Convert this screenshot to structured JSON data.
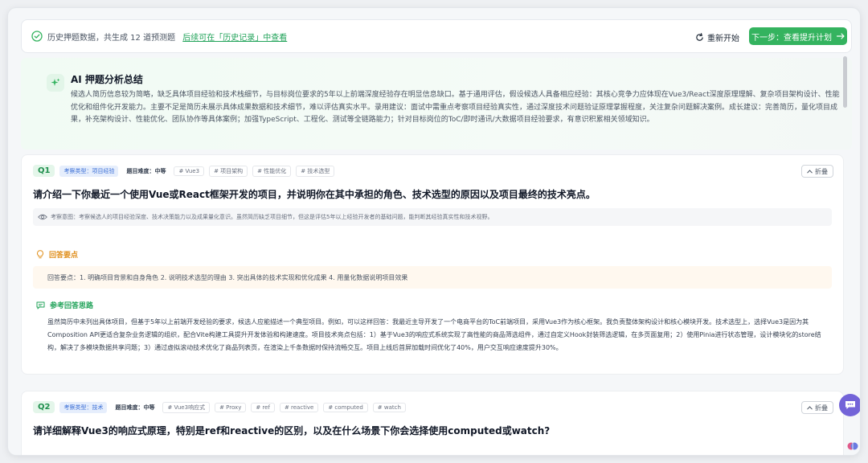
{
  "header": {
    "status_text": "历史押题数据，共生成 12 道预测题",
    "history_link": "后续可在「历史记录」中查看",
    "restart_label": "重新开始",
    "next_label": "下一步：查看提升计划"
  },
  "summary": {
    "title": "AI 押题分析总结",
    "body": "候选人简历信息较为简略，缺乏具体项目经验和技术栈细节，与目标岗位要求的5年以上前端深度经验存在明显信息缺口。基于通用评估，假设候选人具备相应经验：其核心竞争力应体现在Vue3/React深度原理理解、复杂项目架构设计、性能优化和组件化开发能力。主要不足是简历未展示具体成果数据和技术细节，难以评估真实水平。录用建议：面试中需重点考察项目经验真实性，通过深度技术问题验证原理掌握程度，关注复杂问题解决案例。成长建议：完善简历，量化项目成果，补充架构设计、性能优化、团队协作等具体案例；加强TypeScript、工程化、测试等全链路能力；针对目标岗位的ToC/即时通讯/大数据项目经验要求，有意识积累相关领域知识。"
  },
  "questions": [
    {
      "number": "Q1",
      "type": "考察类型：项目经验",
      "difficulty": "题目难度：中等",
      "tags": [
        "# Vue3",
        "# 项目架构",
        "# 性能优化",
        "# 技术选型"
      ],
      "fold_label": "折叠",
      "title": "请介绍一下你最近一个使用Vue或React框架开发的项目，并说明你在其中承担的角色、技术选型的原因以及项目最终的技术亮点。",
      "intent": "考察意图：考察候选人的项目经验深度、技术决策能力以及成果量化意识。虽然简历缺乏项目细节，但这是评估5年以上经验开发者的基础问题，能判断其经验真实性和技术视野。",
      "points_heading": "回答要点",
      "points": "回答要点：1. 明确项目背景和自身角色 2. 说明技术选型的理由 3. 突出具体的技术实现和优化成果 4. 用量化数据说明项目效果",
      "answer_heading": "参考回答思路",
      "answer": "虽然简历中未列出具体项目，但基于5年以上前端开发经验的要求，候选人应能描述一个典型项目。例如，可以这样回答：我最近主导开发了一个电商平台的ToC前端项目，采用Vue3作为核心框架。我负责整体架构设计和核心模块开发。技术选型上，选择Vue3是因为其Composition API更适合复杂业务逻辑的组织，配合Vite构建工具提升开发体验和构建速度。项目技术亮点包括：1）基于Vue3的响应式系统实现了高性能的商品筛选组件，通过自定义Hook封装筛选逻辑，在多页面复用；2）使用Pinia进行状态管理，设计模块化的store结构，解决了多模块数据共享问题；3）通过虚拟滚动技术优化了商品列表页，在渲染上千条数据时保持流畅交互。项目上线后首屏加载时间优化了40%，用户交互响应速度提升30%。"
    },
    {
      "number": "Q2",
      "type": "考察类型：技术",
      "difficulty": "题目难度：中等",
      "tags": [
        "# Vue3响应式",
        "# Proxy",
        "# ref",
        "# reactive",
        "# computed",
        "# watch"
      ],
      "fold_label": "折叠",
      "title": "请详细解释Vue3的响应式原理，特别是ref和reactive的区别，以及在什么场景下你会选择使用computed或watch?"
    }
  ],
  "colors": {
    "accent_green": "#34b35f",
    "chat_purple": "#7364d8",
    "points_orange": "#e0901e"
  }
}
